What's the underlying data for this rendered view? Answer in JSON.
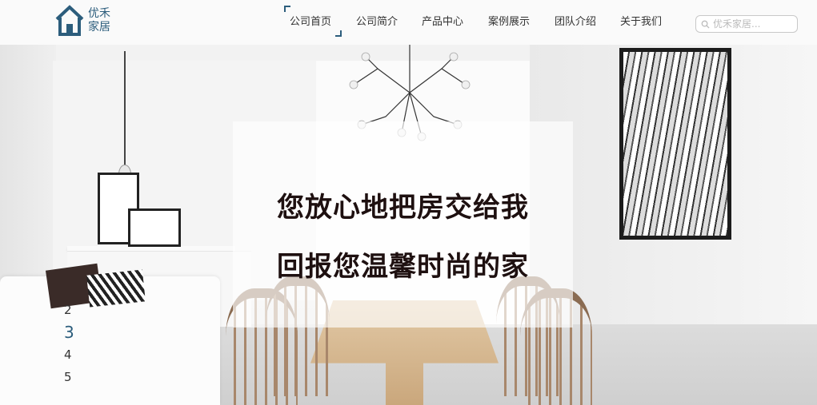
{
  "brand": {
    "line1": "优禾",
    "line2": "家居",
    "color": "#2c5d7c"
  },
  "nav": {
    "items": [
      {
        "label": "公司首页",
        "active": true
      },
      {
        "label": "公司简介",
        "active": false
      },
      {
        "label": "产品中心",
        "active": false
      },
      {
        "label": "案例展示",
        "active": false
      },
      {
        "label": "团队介绍",
        "active": false
      },
      {
        "label": "关于我们",
        "active": false
      }
    ]
  },
  "search": {
    "placeholder": "优禾家居...",
    "icon": "search-icon"
  },
  "hero": {
    "slogan_line1": "您放心地把房交给我",
    "slogan_line2": "回报您温馨时尚的家"
  },
  "pager": {
    "items": [
      "2",
      "3",
      "4",
      "5"
    ],
    "active_index": 1
  }
}
